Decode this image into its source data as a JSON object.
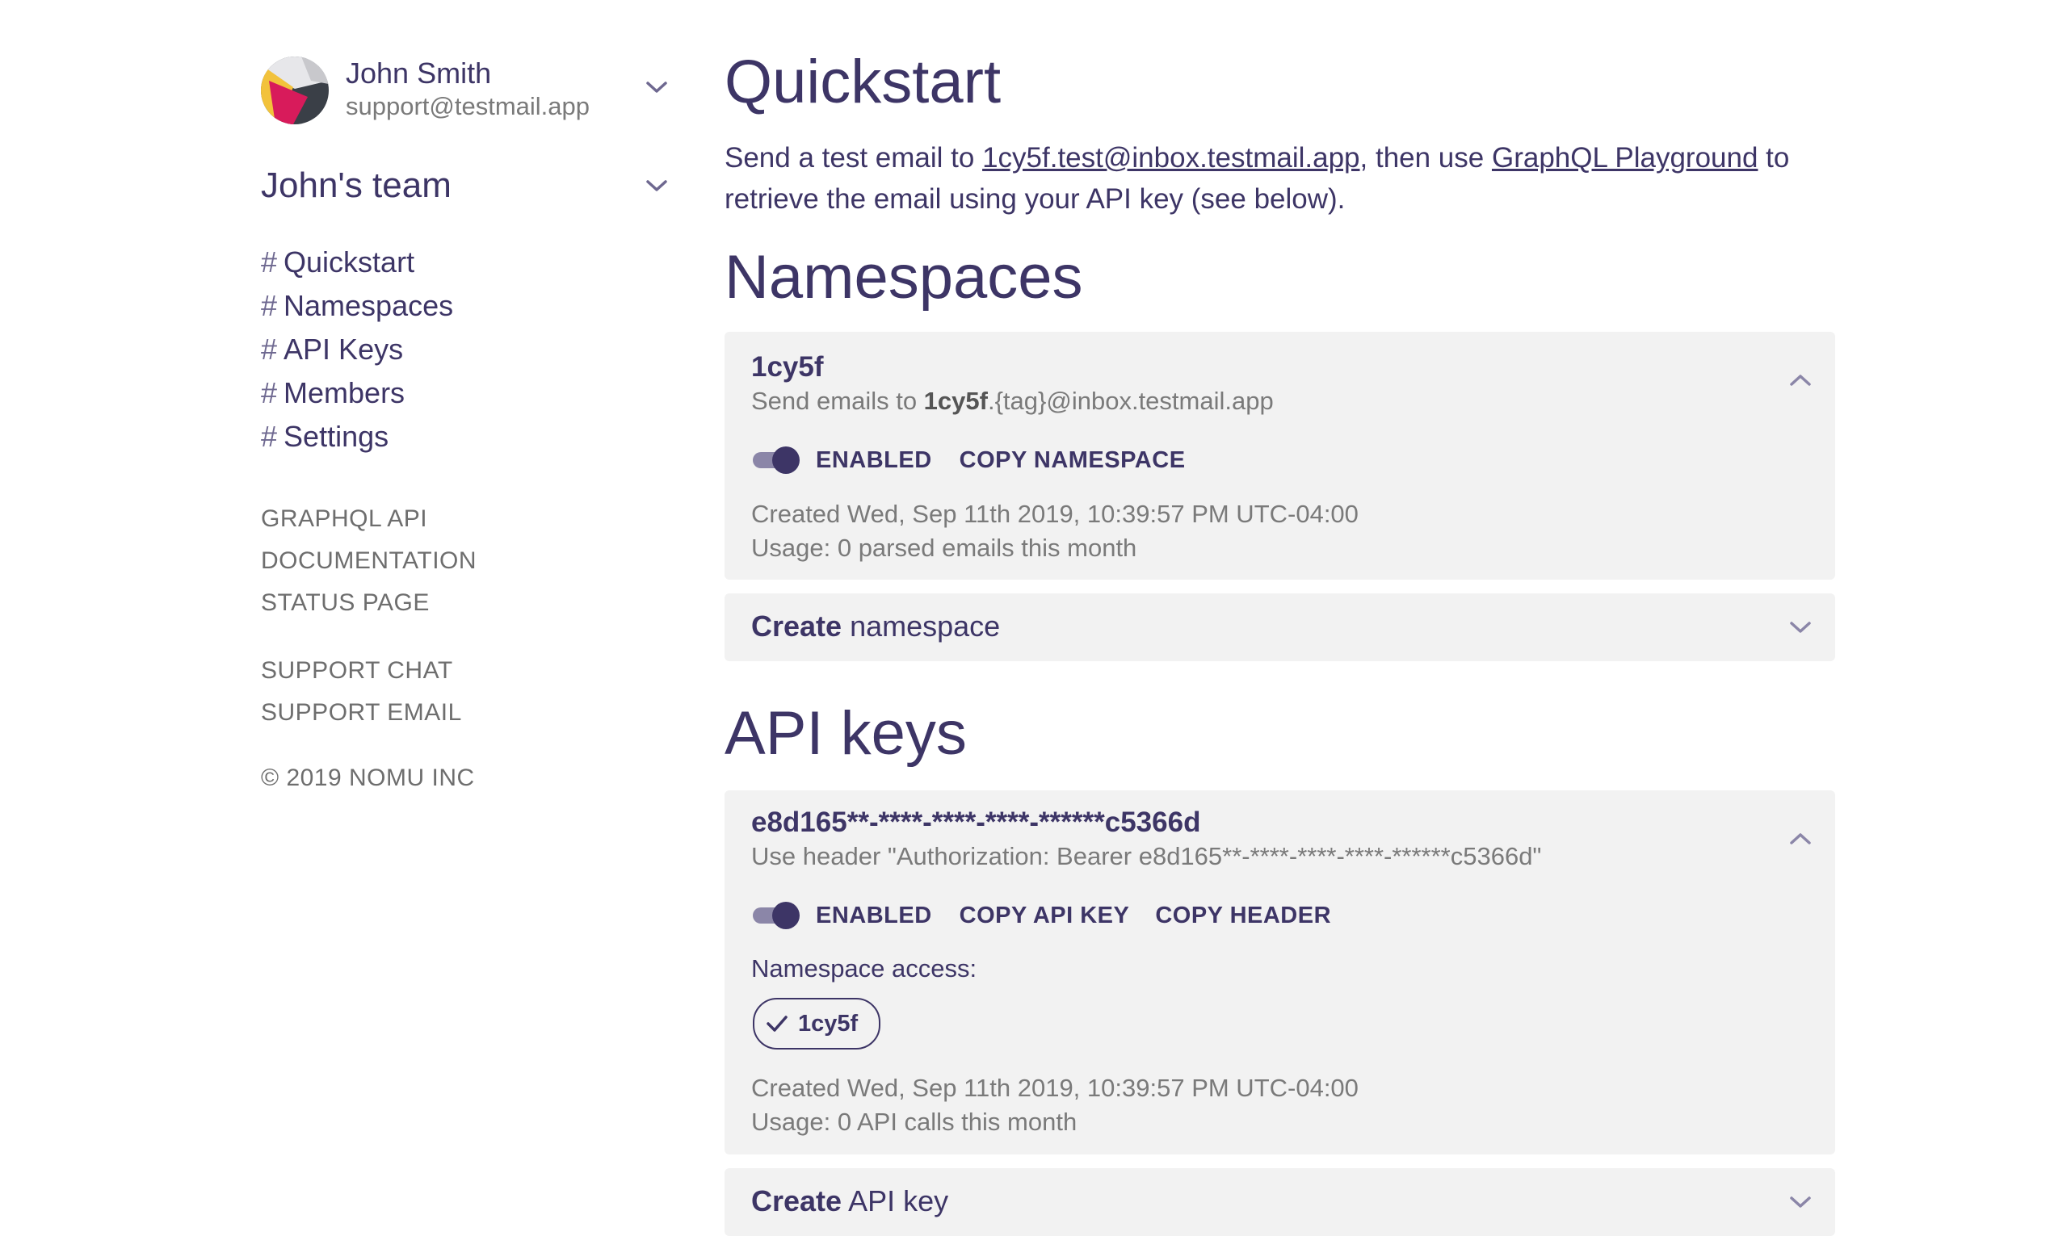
{
  "user": {
    "name": "John Smith",
    "email": "support@testmail.app",
    "avatar": "avatar"
  },
  "team": {
    "name": "John's team"
  },
  "nav": {
    "hash": "#",
    "items": [
      {
        "label": "Quickstart"
      },
      {
        "label": "Namespaces"
      },
      {
        "label": "API Keys"
      },
      {
        "label": "Members"
      },
      {
        "label": "Settings"
      }
    ]
  },
  "links": [
    "GRAPHQL API",
    "DOCUMENTATION",
    "STATUS PAGE"
  ],
  "support_links": [
    "SUPPORT CHAT",
    "SUPPORT EMAIL"
  ],
  "copyright": "© 2019 NOMU INC",
  "quickstart": {
    "title": "Quickstart",
    "text_1": "Send a test email to ",
    "email_link": "1cy5f.test@inbox.testmail.app",
    "text_2": ", then use ",
    "playground_link": "GraphQL Playground",
    "text_3": " to retrieve the email using your API key (see below)."
  },
  "namespaces": {
    "title": "Namespaces",
    "item": {
      "name": "1cy5f",
      "sub_prefix": "Send emails to ",
      "sub_bold": "1cy5f",
      "sub_suffix": ".{tag}@inbox.testmail.app",
      "enabled_label": "ENABLED",
      "enabled": true,
      "copy_label": "COPY NAMESPACE",
      "created": "Created Wed, Sep 11th 2019, 10:39:57 PM UTC-04:00",
      "usage": "Usage: 0 parsed emails this month"
    },
    "create": {
      "bold": "Create",
      "rest": " namespace"
    }
  },
  "api_keys": {
    "title": "API keys",
    "item": {
      "key": "e8d165**-****-****-****-******c5366d",
      "header_hint": "Use header \"Authorization: Bearer e8d165**-****-****-****-******c5366d\"",
      "enabled_label": "ENABLED",
      "enabled": true,
      "copy_key_label": "COPY API KEY",
      "copy_header_label": "COPY HEADER",
      "ns_access_label": "Namespace access:",
      "ns_chip": "1cy5f",
      "created": "Created Wed, Sep 11th 2019, 10:39:57 PM UTC-04:00",
      "usage": "Usage: 0 API calls this month"
    },
    "create": {
      "bold": "Create",
      "rest": " API key"
    }
  },
  "colors": {
    "primary": "#3d3566",
    "muted": "#7a7a7a",
    "panel_bg": "#f2f2f2",
    "toggle_track": "#8b86a8"
  },
  "icons": [
    "chevron-down-icon",
    "chevron-up-icon",
    "check-icon",
    "avatar"
  ]
}
